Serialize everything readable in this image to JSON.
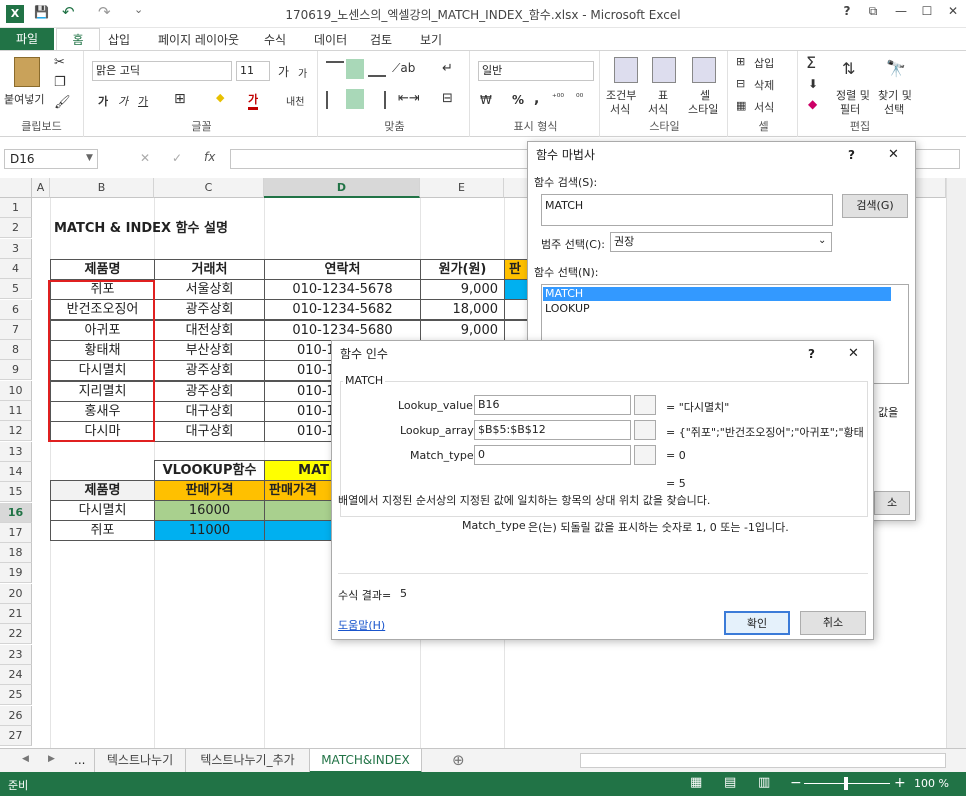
{
  "window": {
    "title": "170619_노센스의_엑셀강의_MATCH_INDEX_함수.xlsx - Microsoft Excel",
    "btn_help": "?",
    "btn_restore": "⧉",
    "btn_min": "—",
    "btn_max": "☐",
    "btn_close": "✕"
  },
  "quick": {
    "save": "💾",
    "undo": "↶",
    "redo": "↷",
    "more": "⌄"
  },
  "ribbon_tabs": [
    "파일",
    "홈",
    "삽입",
    "페이지 레이아웃",
    "수식",
    "데이터",
    "검토",
    "보기"
  ],
  "ribbon": {
    "clipboard": {
      "paste": "붙여넣기",
      "label": "클립보드"
    },
    "font": {
      "name": "맑은 고딕",
      "size": "11",
      "grow": "가",
      "shrink": "가",
      "bold": "가",
      "italic": "가",
      "underline": "가",
      "border": "⊞",
      "fill": "◆",
      "color": "가",
      "phonetic": "내천",
      "label": "글꼴"
    },
    "align": {
      "label": "맞춤"
    },
    "number": {
      "format": "일반",
      "currency": "₩",
      "percent": "%",
      "comma": ",",
      "inc": "⁺⁰⁰",
      "dec": "⁰⁰",
      "label": "표시 형식"
    },
    "styles": {
      "cond": "조건부",
      "cond2": "서식",
      "table": "표",
      "table2": "서식",
      "cell": "셀",
      "cell2": "스타일",
      "label": "스타일"
    },
    "cells": {
      "insert": "삽입",
      "delete": "삭제",
      "format": "서식",
      "label": "셀"
    },
    "editing": {
      "sum": "Σ",
      "sort": "정렬 및",
      "sort2": "필터",
      "find": "찾기 및",
      "find2": "선택",
      "label": "편집"
    }
  },
  "formula_bar": {
    "name_box": "D16",
    "cancel": "✕",
    "enter": "✓",
    "fx": "fx",
    "content": ""
  },
  "columns": [
    "A",
    "B",
    "C",
    "D",
    "E"
  ],
  "rows": [
    "1",
    "2",
    "3",
    "4",
    "5",
    "6",
    "7",
    "8",
    "9",
    "10",
    "11",
    "12",
    "13",
    "14",
    "15",
    "16",
    "17",
    "18",
    "19",
    "20",
    "21",
    "22",
    "23",
    "24",
    "25",
    "26",
    "27"
  ],
  "sheet": {
    "title": "MATCH & INDEX 함수 설명",
    "table_headers": [
      "제품명",
      "거래처",
      "연락처",
      "원가(원)",
      "판"
    ],
    "table_rows": [
      [
        "쥐포",
        "서울상회",
        "010-1234-5678",
        "9,000"
      ],
      [
        "반건조오징어",
        "광주상회",
        "010-1234-5682",
        "18,000"
      ],
      [
        "아귀포",
        "대전상회",
        "010-1234-5680",
        "9,000"
      ],
      [
        "황태채",
        "부산상회",
        "010-1",
        ""
      ],
      [
        "다시멸치",
        "광주상회",
        "010-1",
        ""
      ],
      [
        "지리멸치",
        "광주상회",
        "010-1",
        ""
      ],
      [
        "홍새우",
        "대구상회",
        "010-1",
        ""
      ],
      [
        "다시마",
        "대구상회",
        "010-1",
        ""
      ]
    ],
    "vlookup_label": "VLOOKUP함수",
    "match_label": "MAT",
    "lookup_header_b": "제품명",
    "lookup_header_c": "판매가격",
    "lookup_header_d": "판매가격",
    "lookup_rows": [
      [
        "다시멸치",
        "16000"
      ],
      [
        "쥐포",
        "11000"
      ]
    ]
  },
  "sheet_tabs": {
    "nav_prev": "◀",
    "nav_next": "▶",
    "dots": "...",
    "tab1": "텍스트나누기",
    "tab2": "텍스트나누기_추가",
    "tab3": "MATCH&INDEX",
    "add": "⊕"
  },
  "status": {
    "ready": "준비",
    "zoom": "100 %",
    "minus": "−",
    "plus": "+"
  },
  "wizard": {
    "title": "함수 마법사",
    "help": "?",
    "close": "✕",
    "search_label": "함수 검색(S):",
    "search_value": "MATCH",
    "search_btn": "검색(G)",
    "category_label": "범주 선택(C):",
    "category_value": "권장",
    "select_label": "함수 선택(N):",
    "list": [
      "MATCH",
      "LOOKUP"
    ],
    "side_text": "값을",
    "side_btn": "소"
  },
  "args": {
    "title": "함수 인수",
    "help": "?",
    "close": "✕",
    "func": "MATCH",
    "fields": [
      {
        "label": "Lookup_value",
        "value": "B16",
        "result": "=  \"다시멸치\""
      },
      {
        "label": "Lookup_array",
        "value": "$B$5:$B$12",
        "result": "=  {\"쥐포\";\"반건조오징어\";\"아귀포\";\"황태"
      },
      {
        "label": "Match_type",
        "value": "0",
        "result": "=  0"
      }
    ],
    "total": "=  5",
    "description": "배열에서 지정된 순서상의 지정된 값에 일치하는 항목의 상대 위치 값을 찾습니다.",
    "arg_desc_name": "Match_type",
    "arg_desc": "은(는) 되돌릴 값을 표시하는 숫자로 1, 0 또는 -1입니다.",
    "formula_result_label": "수식 결과=",
    "formula_result": "5",
    "help_link": "도움말(H)",
    "ok": "확인",
    "cancel": "취소"
  },
  "colors": {
    "excel_green": "#217346",
    "header_yellow": "#ffc000",
    "match_yellow": "#ffff00",
    "lookup_green": "#a9d08e",
    "lookup_blue": "#00b0f0",
    "red_box": "#e02020"
  }
}
